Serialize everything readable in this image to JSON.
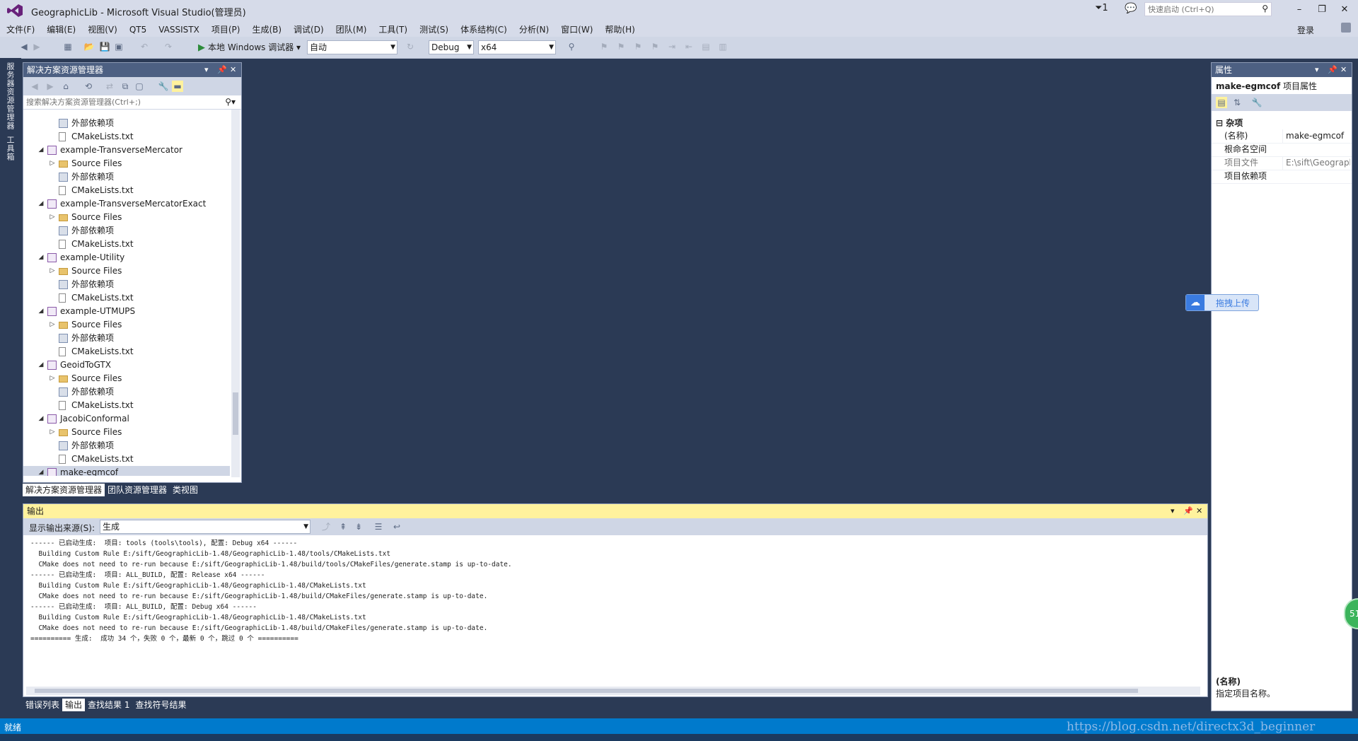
{
  "window": {
    "title": "GeographicLib - Microsoft Visual Studio(管理员)",
    "filter_count": "1",
    "quick_launch_placeholder": "快速启动 (Ctrl+Q)",
    "controls": {
      "minimize": "–",
      "restore": "❐",
      "close": "✕"
    }
  },
  "menu": {
    "items": [
      "文件(F)",
      "编辑(E)",
      "视图(V)",
      "QT5",
      "VASSISTX",
      "项目(P)",
      "生成(B)",
      "调试(D)",
      "团队(M)",
      "工具(T)",
      "测试(S)",
      "体系结构(C)",
      "分析(N)",
      "窗口(W)",
      "帮助(H)"
    ],
    "login": "登录"
  },
  "toolbar": {
    "debugger": "本地 Windows 调试器",
    "solution_config": "自动",
    "build_config": "Debug",
    "platform": "x64"
  },
  "leftstrip": {
    "tab1": "服务器资源管理器",
    "tab2": "工具箱"
  },
  "solution_explorer": {
    "title": "解决方案资源管理器",
    "search_placeholder": "搜索解决方案资源管理器(Ctrl+;)",
    "tree": [
      {
        "level": 2,
        "icon": "ext",
        "label": "外部依赖项"
      },
      {
        "level": 2,
        "icon": "file",
        "label": "CMakeLists.txt"
      },
      {
        "level": 1,
        "icon": "proj",
        "label": "example-TransverseMercator",
        "expanded": true
      },
      {
        "level": 2,
        "icon": "folder",
        "label": "Source Files",
        "collapsed": true
      },
      {
        "level": 2,
        "icon": "ext",
        "label": "外部依赖项"
      },
      {
        "level": 2,
        "icon": "file",
        "label": "CMakeLists.txt"
      },
      {
        "level": 1,
        "icon": "proj",
        "label": "example-TransverseMercatorExact",
        "expanded": true
      },
      {
        "level": 2,
        "icon": "folder",
        "label": "Source Files",
        "collapsed": true
      },
      {
        "level": 2,
        "icon": "ext",
        "label": "外部依赖项"
      },
      {
        "level": 2,
        "icon": "file",
        "label": "CMakeLists.txt"
      },
      {
        "level": 1,
        "icon": "proj",
        "label": "example-Utility",
        "expanded": true
      },
      {
        "level": 2,
        "icon": "folder",
        "label": "Source Files",
        "collapsed": true
      },
      {
        "level": 2,
        "icon": "ext",
        "label": "外部依赖项"
      },
      {
        "level": 2,
        "icon": "file",
        "label": "CMakeLists.txt"
      },
      {
        "level": 1,
        "icon": "proj",
        "label": "example-UTMUPS",
        "expanded": true
      },
      {
        "level": 2,
        "icon": "folder",
        "label": "Source Files",
        "collapsed": true
      },
      {
        "level": 2,
        "icon": "ext",
        "label": "外部依赖项"
      },
      {
        "level": 2,
        "icon": "file",
        "label": "CMakeLists.txt"
      },
      {
        "level": 1,
        "icon": "proj",
        "label": "GeoidToGTX",
        "expanded": true
      },
      {
        "level": 2,
        "icon": "folder",
        "label": "Source Files",
        "collapsed": true
      },
      {
        "level": 2,
        "icon": "ext",
        "label": "外部依赖项"
      },
      {
        "level": 2,
        "icon": "file",
        "label": "CMakeLists.txt"
      },
      {
        "level": 1,
        "icon": "proj",
        "label": "JacobiConformal",
        "expanded": true
      },
      {
        "level": 2,
        "icon": "folder",
        "label": "Source Files",
        "collapsed": true
      },
      {
        "level": 2,
        "icon": "ext",
        "label": "外部依赖项"
      },
      {
        "level": 2,
        "icon": "file",
        "label": "CMakeLists.txt"
      },
      {
        "level": 1,
        "icon": "proj",
        "label": "make-egmcof",
        "expanded": true,
        "selected": true
      }
    ],
    "tabs": [
      "解决方案资源管理器",
      "团队资源管理器",
      "类视图"
    ]
  },
  "output": {
    "title": "输出",
    "source_label": "显示输出来源(S):",
    "source_value": "生成",
    "lines": [
      "------ 已启动生成:  项目: tools (tools\\tools), 配置: Debug x64 ------",
      "  Building Custom Rule E:/sift/GeographicLib-1.48/GeographicLib-1.48/tools/CMakeLists.txt",
      "  CMake does not need to re-run because E:/sift/GeographicLib-1.48/build/tools/CMakeFiles/generate.stamp is up-to-date.",
      "------ 已启动生成:  项目: ALL_BUILD, 配置: Release x64 ------",
      "  Building Custom Rule E:/sift/GeographicLib-1.48/GeographicLib-1.48/CMakeLists.txt",
      "  CMake does not need to re-run because E:/sift/GeographicLib-1.48/build/CMakeFiles/generate.stamp is up-to-date.",
      "------ 已启动生成:  项目: ALL_BUILD, 配置: Debug x64 ------",
      "  Building Custom Rule E:/sift/GeographicLib-1.48/GeographicLib-1.48/CMakeLists.txt",
      "  CMake does not need to re-run because E:/sift/GeographicLib-1.48/build/CMakeFiles/generate.stamp is up-to-date.",
      "========== 生成:  成功 34 个，失败 0 个，最新 0 个，跳过 0 个 =========="
    ],
    "tabs": [
      "错误列表",
      "输出",
      "查找结果 1",
      "查找符号结果"
    ]
  },
  "properties": {
    "title": "属性",
    "object_name": "make-egmcof",
    "object_type": "项目属性",
    "category": "杂项",
    "rows": [
      {
        "name": "(名称)",
        "value": "make-egmcof",
        "dim": false
      },
      {
        "name": "根命名空间",
        "value": "",
        "dim": false
      },
      {
        "name": "项目文件",
        "value": "E:\\sift\\Geographi",
        "dim": true
      },
      {
        "name": "项目依赖项",
        "value": "",
        "dim": false
      }
    ],
    "desc_title": "(名称)",
    "desc_text": "指定项目名称。"
  },
  "upload": {
    "label": "拖拽上传"
  },
  "badge": {
    "text": "51"
  },
  "status": {
    "text": "就绪",
    "watermark": "https://blog.csdn.net/directx3d_beginner"
  }
}
